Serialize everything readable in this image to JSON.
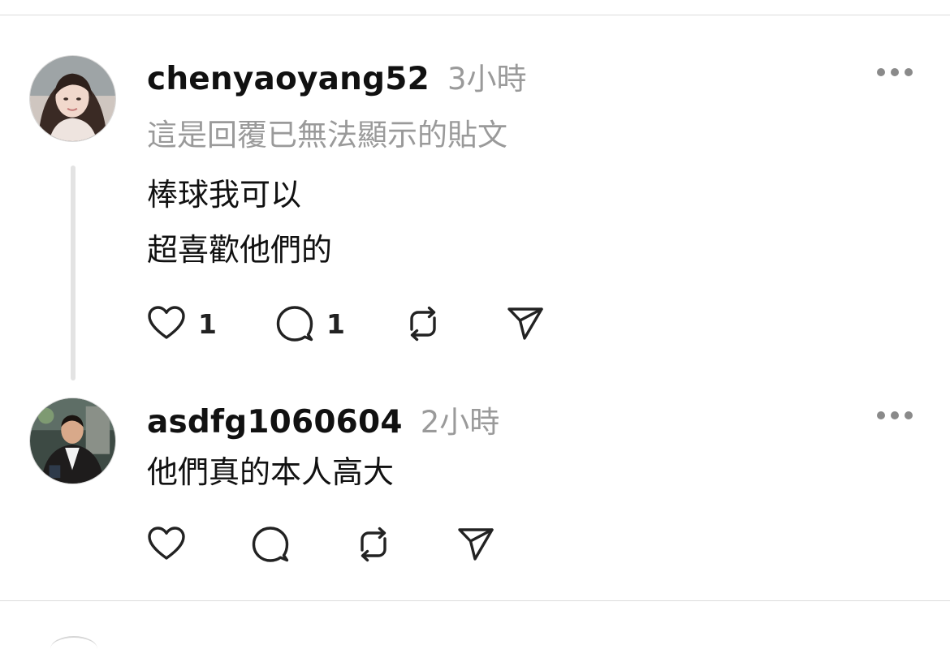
{
  "posts": [
    {
      "username": "chenyaoyang52",
      "time": "3小時",
      "reply_note": "這是回覆已無法顯示的貼文",
      "lines": [
        "棒球我可以",
        "超喜歡他們的"
      ],
      "actions": {
        "like_count": "1",
        "comment_count": "1"
      },
      "more_icon": "more-horizontal-icon"
    },
    {
      "username": "asdfg1060604",
      "time": "2小時",
      "lines": [
        "他們真的本人高大"
      ],
      "actions": {},
      "more_icon": "more-horizontal-icon"
    }
  ],
  "icons": [
    "heart-icon",
    "comment-icon",
    "repost-icon",
    "share-icon"
  ],
  "colors": {
    "text": "#111111",
    "muted": "#9a9a9a",
    "divider": "#dcdcdc",
    "thread_line": "#e3e3e3"
  }
}
